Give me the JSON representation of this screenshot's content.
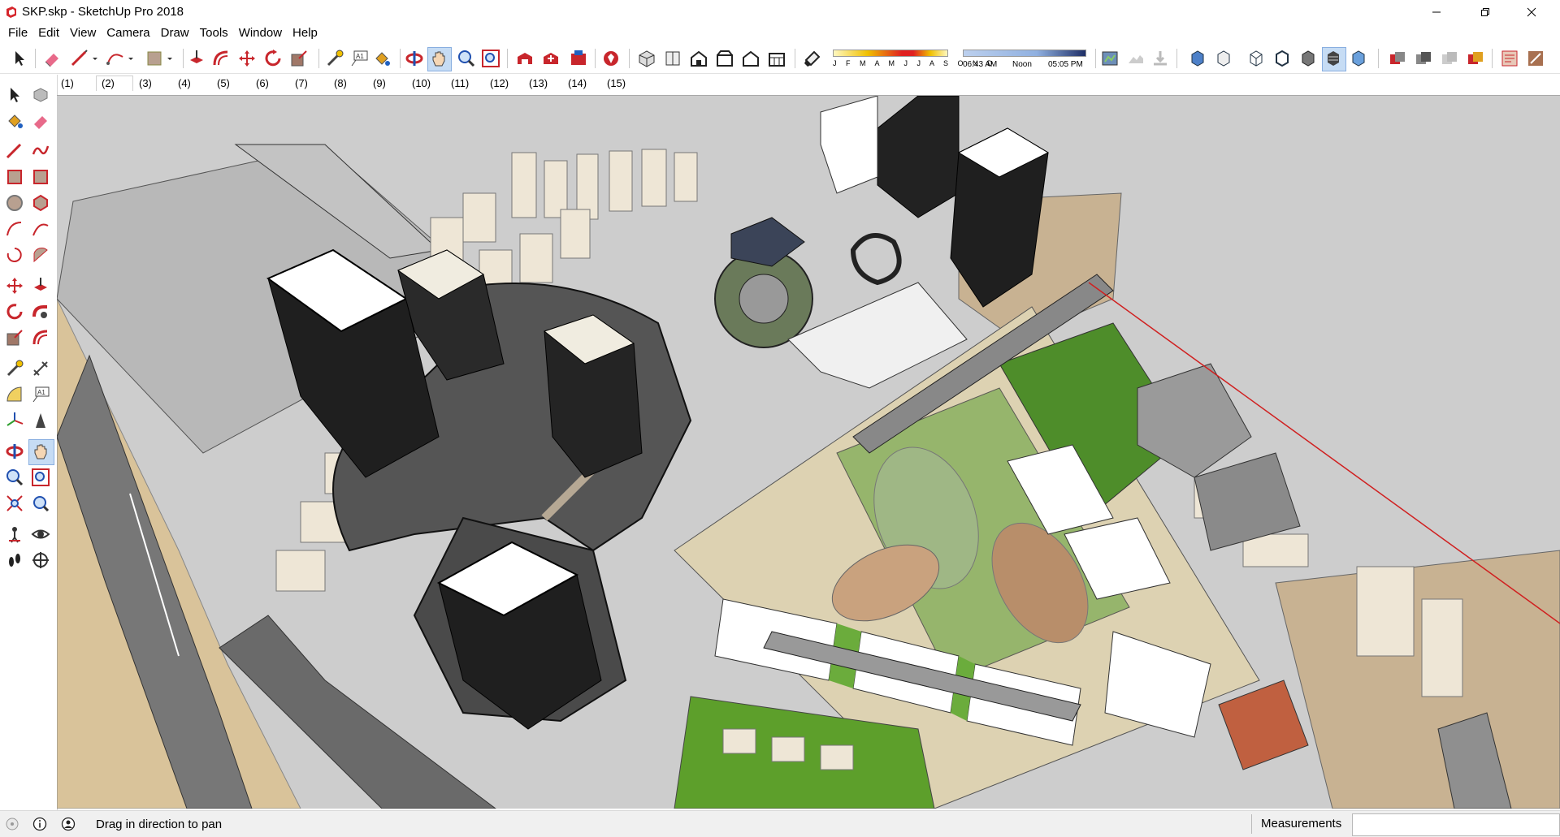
{
  "window": {
    "title": "SKP.skp - SketchUp Pro 2018"
  },
  "menu": [
    "File",
    "Edit",
    "View",
    "Camera",
    "Draw",
    "Tools",
    "Window",
    "Help"
  ],
  "toolbar": {
    "shadow": {
      "months": "J F M A M J J A S O N D",
      "time_start": "06:43 AM",
      "time_noon": "Noon",
      "time_end": "05:05 PM"
    },
    "active_tool": "pan-icon"
  },
  "scenes": {
    "tabs": [
      "(1)",
      "(2)",
      "(3)",
      "(4)",
      "(5)",
      "(6)",
      "(7)",
      "(8)",
      "(9)",
      "(10)",
      "(11)",
      "(12)",
      "(13)",
      "(14)",
      "(15)"
    ],
    "active": "(2)"
  },
  "colors": {
    "accent_red": "#c8262c",
    "selection_blue": "#c6dcf4",
    "ground_grey": "#c8c8c8",
    "grass_green": "#5e9a2e",
    "sand": "#d9c39a"
  },
  "status": {
    "hint": "Drag in direction to pan",
    "measurements_label": "Measurements",
    "measurements_value": ""
  }
}
